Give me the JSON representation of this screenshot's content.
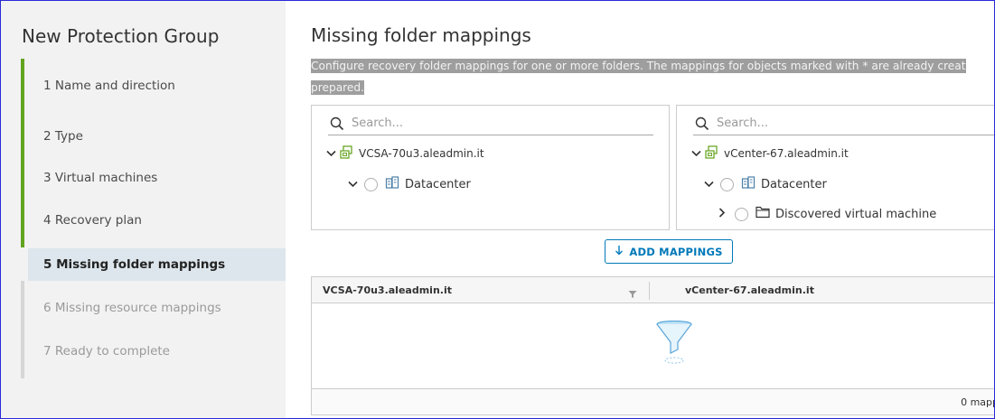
{
  "wizard": {
    "title": "New Protection Group",
    "steps": [
      {
        "label": "1  Name and direction",
        "state": "done"
      },
      {
        "label": "2  Type",
        "state": "done"
      },
      {
        "label": "3  Virtual machines",
        "state": "done"
      },
      {
        "label": "4  Recovery plan",
        "state": "done"
      },
      {
        "label": "5  Missing folder mappings",
        "state": "current"
      },
      {
        "label": "6  Missing resource mappings",
        "state": "disabled"
      },
      {
        "label": "7  Ready to complete",
        "state": "disabled"
      }
    ],
    "colors": {
      "done_bar": "#62a420",
      "current_bg": "#dde6ec",
      "disabled_text": "#9a9a9a"
    }
  },
  "main": {
    "title": "Missing folder mappings",
    "description": "Configure recovery folder mappings for one or more folders. The mappings for objects marked with * are already creat prepared."
  },
  "left_tree": {
    "search_placeholder": "Search...",
    "vcenter": "VCSA-70u3.aleadmin.it",
    "datacenter": "Datacenter"
  },
  "right_tree": {
    "search_placeholder": "Search...",
    "vcenter": "vCenter-67.aleadmin.it",
    "datacenter": "Datacenter",
    "folder": "Discovered virtual machine"
  },
  "add_mappings_label": "ADD MAPPINGS",
  "grid": {
    "col_source": "VCSA-70u3.aleadmin.it",
    "col_target": "vCenter-67.aleadmin.it",
    "footer": "0 mapp"
  },
  "icons": [
    "search-icon",
    "chevron-down-icon",
    "chevron-right-icon",
    "vcenter-icon",
    "datacenter-icon",
    "folder-icon",
    "filter-icon",
    "arrow-down-icon"
  ],
  "accent": "#0079b8"
}
